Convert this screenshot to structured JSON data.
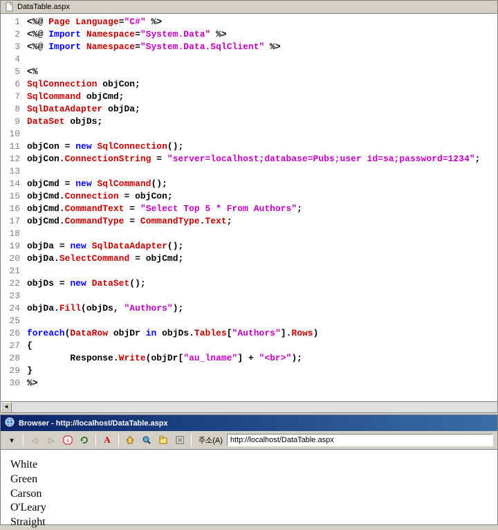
{
  "editor": {
    "filename": "DataTable.aspx",
    "lines": [
      [
        [
          "black",
          "<%@"
        ],
        [
          "space",
          " "
        ],
        [
          "red",
          "Page"
        ],
        [
          "space",
          " "
        ],
        [
          "red",
          "Language"
        ],
        [
          "black",
          "="
        ],
        [
          "magenta",
          "\"C#\""
        ],
        [
          "space",
          " "
        ],
        [
          "black",
          "%>"
        ]
      ],
      [
        [
          "black",
          "<%@"
        ],
        [
          "space",
          " "
        ],
        [
          "blue",
          "Import"
        ],
        [
          "space",
          " "
        ],
        [
          "red",
          "Namespace"
        ],
        [
          "black",
          "="
        ],
        [
          "magenta",
          "\"System.Data\""
        ],
        [
          "space",
          " "
        ],
        [
          "black",
          "%>"
        ]
      ],
      [
        [
          "black",
          "<%@"
        ],
        [
          "space",
          " "
        ],
        [
          "blue",
          "Import"
        ],
        [
          "space",
          " "
        ],
        [
          "red",
          "Namespace"
        ],
        [
          "black",
          "="
        ],
        [
          "magenta",
          "\"System.Data.SqlClient\""
        ],
        [
          "space",
          " "
        ],
        [
          "black",
          "%>"
        ]
      ],
      [],
      [
        [
          "black",
          "<%"
        ]
      ],
      [
        [
          "red",
          "SqlConnection"
        ],
        [
          "space",
          " "
        ],
        [
          "black",
          "objCon"
        ],
        [
          "black",
          ";"
        ]
      ],
      [
        [
          "red",
          "SqlCommand"
        ],
        [
          "space",
          " "
        ],
        [
          "black",
          "objCmd"
        ],
        [
          "black",
          ";"
        ]
      ],
      [
        [
          "red",
          "SqlDataAdapter"
        ],
        [
          "space",
          " "
        ],
        [
          "black",
          "objDa"
        ],
        [
          "black",
          ";"
        ]
      ],
      [
        [
          "red",
          "DataSet"
        ],
        [
          "space",
          " "
        ],
        [
          "black",
          "objDs"
        ],
        [
          "black",
          ";"
        ]
      ],
      [],
      [
        [
          "black",
          "objCon"
        ],
        [
          "space",
          " "
        ],
        [
          "black",
          "="
        ],
        [
          "space",
          " "
        ],
        [
          "blue",
          "new"
        ],
        [
          "space",
          " "
        ],
        [
          "red",
          "SqlConnection"
        ],
        [
          "black",
          "();"
        ]
      ],
      [
        [
          "black",
          "objCon"
        ],
        [
          "black",
          "."
        ],
        [
          "red",
          "ConnectionString"
        ],
        [
          "space",
          " "
        ],
        [
          "black",
          "="
        ],
        [
          "space",
          " "
        ],
        [
          "magenta",
          "\"server=localhost;database=Pubs;user id=sa;password=1234\""
        ],
        [
          "black",
          ";"
        ]
      ],
      [],
      [
        [
          "black",
          "objCmd"
        ],
        [
          "space",
          " "
        ],
        [
          "black",
          "="
        ],
        [
          "space",
          " "
        ],
        [
          "blue",
          "new"
        ],
        [
          "space",
          " "
        ],
        [
          "red",
          "SqlCommand"
        ],
        [
          "black",
          "();"
        ]
      ],
      [
        [
          "black",
          "objCmd"
        ],
        [
          "black",
          "."
        ],
        [
          "red",
          "Connection"
        ],
        [
          "space",
          " "
        ],
        [
          "black",
          "="
        ],
        [
          "space",
          " "
        ],
        [
          "black",
          "objCon"
        ],
        [
          "black",
          ";"
        ]
      ],
      [
        [
          "black",
          "objCmd"
        ],
        [
          "black",
          "."
        ],
        [
          "red",
          "CommandText"
        ],
        [
          "space",
          " "
        ],
        [
          "black",
          "="
        ],
        [
          "space",
          " "
        ],
        [
          "magenta",
          "\"Select Top 5 * From Authors\""
        ],
        [
          "black",
          ";"
        ]
      ],
      [
        [
          "black",
          "objCmd"
        ],
        [
          "black",
          "."
        ],
        [
          "red",
          "CommandType"
        ],
        [
          "space",
          " "
        ],
        [
          "black",
          "="
        ],
        [
          "space",
          " "
        ],
        [
          "red",
          "CommandType"
        ],
        [
          "black",
          "."
        ],
        [
          "red",
          "Text"
        ],
        [
          "black",
          ";"
        ]
      ],
      [],
      [
        [
          "black",
          "objDa"
        ],
        [
          "space",
          " "
        ],
        [
          "black",
          "="
        ],
        [
          "space",
          " "
        ],
        [
          "blue",
          "new"
        ],
        [
          "space",
          " "
        ],
        [
          "red",
          "SqlDataAdapter"
        ],
        [
          "black",
          "();"
        ]
      ],
      [
        [
          "black",
          "objDa"
        ],
        [
          "black",
          "."
        ],
        [
          "red",
          "SelectCommand"
        ],
        [
          "space",
          " "
        ],
        [
          "black",
          "="
        ],
        [
          "space",
          " "
        ],
        [
          "black",
          "objCmd"
        ],
        [
          "black",
          ";"
        ]
      ],
      [],
      [
        [
          "black",
          "objDs"
        ],
        [
          "space",
          " "
        ],
        [
          "black",
          "="
        ],
        [
          "space",
          " "
        ],
        [
          "blue",
          "new"
        ],
        [
          "space",
          " "
        ],
        [
          "red",
          "DataSet"
        ],
        [
          "black",
          "();"
        ]
      ],
      [],
      [
        [
          "black",
          "objDa"
        ],
        [
          "black",
          "."
        ],
        [
          "red",
          "Fill"
        ],
        [
          "black",
          "(objDs"
        ],
        [
          "black",
          ","
        ],
        [
          "space",
          " "
        ],
        [
          "magenta",
          "\"Authors\""
        ],
        [
          "black",
          ");"
        ]
      ],
      [],
      [
        [
          "blue",
          "foreach"
        ],
        [
          "black",
          "("
        ],
        [
          "red",
          "DataRow"
        ],
        [
          "space",
          " "
        ],
        [
          "black",
          "objDr"
        ],
        [
          "space",
          " "
        ],
        [
          "blue",
          "in"
        ],
        [
          "space",
          " "
        ],
        [
          "black",
          "objDs"
        ],
        [
          "black",
          "."
        ],
        [
          "red",
          "Tables"
        ],
        [
          "black",
          "["
        ],
        [
          "magenta",
          "\"Authors\""
        ],
        [
          "black",
          "]"
        ],
        [
          "black",
          "."
        ],
        [
          "red",
          "Rows"
        ],
        [
          "black",
          ")"
        ]
      ],
      [
        [
          "black",
          "{"
        ]
      ],
      [
        [
          "black",
          "        Response"
        ],
        [
          "black",
          "."
        ],
        [
          "red",
          "Write"
        ],
        [
          "black",
          "(objDr["
        ],
        [
          "magenta",
          "\"au_lname\""
        ],
        [
          "black",
          "]"
        ],
        [
          "space",
          " "
        ],
        [
          "black",
          "+"
        ],
        [
          "space",
          " "
        ],
        [
          "magenta",
          "\"<br>\""
        ],
        [
          "black",
          ");"
        ]
      ],
      [
        [
          "black",
          "}"
        ]
      ],
      [
        [
          "black",
          "%>"
        ]
      ]
    ]
  },
  "browser": {
    "title_prefix": "Browser - ",
    "url_display": "http://localhost/DataTable.aspx",
    "address_label": "주소(A)",
    "address_value": "http://localhost/DataTable.aspx",
    "output": [
      "White",
      "Green",
      "Carson",
      "O'Leary",
      "Straight"
    ]
  }
}
